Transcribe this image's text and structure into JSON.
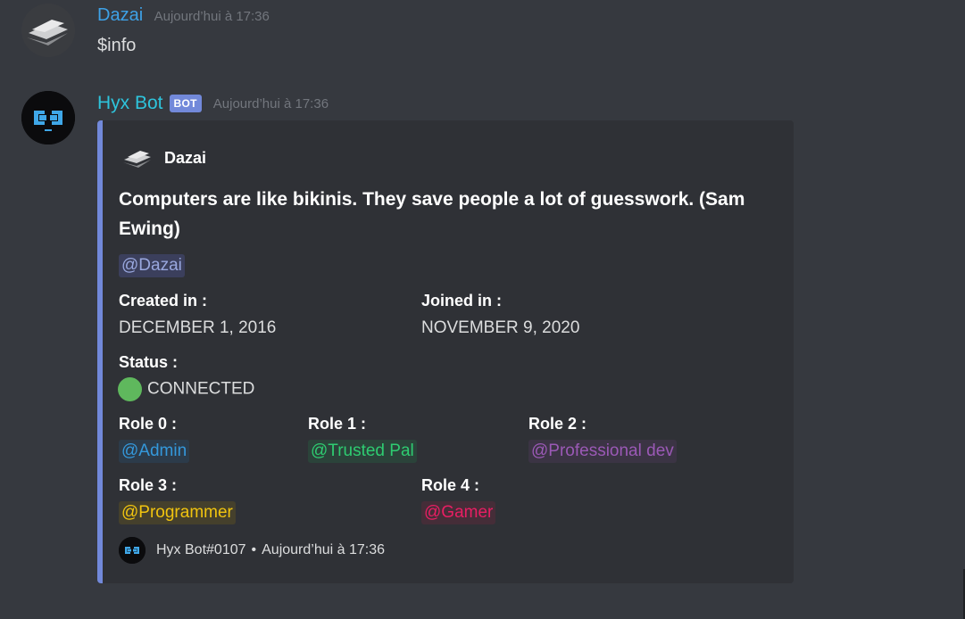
{
  "messages": [
    {
      "author": "Dazai",
      "timestamp": "Aujourd’hui à 17:36",
      "content": "$info"
    },
    {
      "author": "Hyx Bot",
      "bot_tag": "BOT",
      "timestamp": "Aujourd’hui à 17:36"
    }
  ],
  "embed": {
    "accent_color": "#7289da",
    "author_name": "Dazai",
    "title": "Computers are like bikinis. They save people a lot of guesswork. (Sam Ewing)",
    "mention": "@Dazai",
    "fields": {
      "created": {
        "name": "Created in :",
        "value": "DECEMBER 1, 2016"
      },
      "joined": {
        "name": "Joined in :",
        "value": "NOVEMBER 9, 2020"
      },
      "status": {
        "name": "Status :",
        "value": "CONNECTED",
        "status_color": "#5fb85d"
      },
      "role0": {
        "name": "Role 0 :",
        "value": "@Admin",
        "color": "#3498db"
      },
      "role1": {
        "name": "Role 1 :",
        "value": "@Trusted Pal",
        "color": "#2ecc71"
      },
      "role2": {
        "name": "Role 2 :",
        "value": "@Professional dev",
        "color": "#9b59b6"
      },
      "role3": {
        "name": "Role 3 :",
        "value": "@Programmer",
        "color": "#f1c40f"
      },
      "role4": {
        "name": "Role 4 :",
        "value": "@Gamer",
        "color": "#e91e63"
      }
    },
    "footer": {
      "text": "Hyx Bot#0107",
      "separator": "•",
      "timestamp": "Aujourd’hui à 17:36"
    }
  },
  "icons": {
    "user_avatar": "striped-dazai-avatar-icon",
    "bot_avatar": "hyx-bot-logo-icon"
  }
}
